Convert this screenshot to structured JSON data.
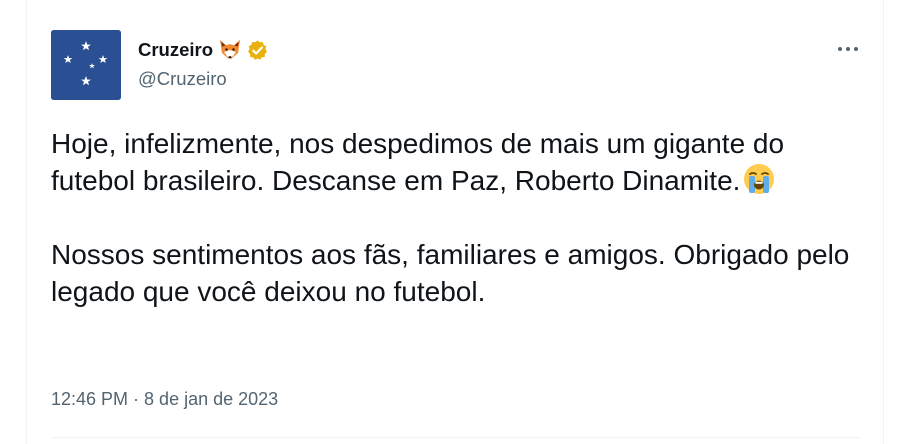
{
  "author": {
    "display_name": "Cruzeiro",
    "handle": "@Cruzeiro",
    "badge_emoji": "fox-face",
    "verified": true,
    "verified_color": "#e8b10e",
    "avatar_color": "#2a4f93"
  },
  "tweet": {
    "paragraph_1": "Hoje, infelizmente, nos despedimos de mais um gigante do futebol brasileiro. Descanse em Paz, Roberto Dinamite.",
    "paragraph_1_emoji": "loudly-crying-face",
    "paragraph_2": "Nossos sentimentos aos fãs, familiares e amigos. Obrigado pelo legado que você deixou no futebol."
  },
  "meta": {
    "time": "12:46 PM",
    "separator": "·",
    "date": "8 de jan de 2023"
  },
  "menu": {
    "more_icon": "more-horizontal-icon"
  }
}
